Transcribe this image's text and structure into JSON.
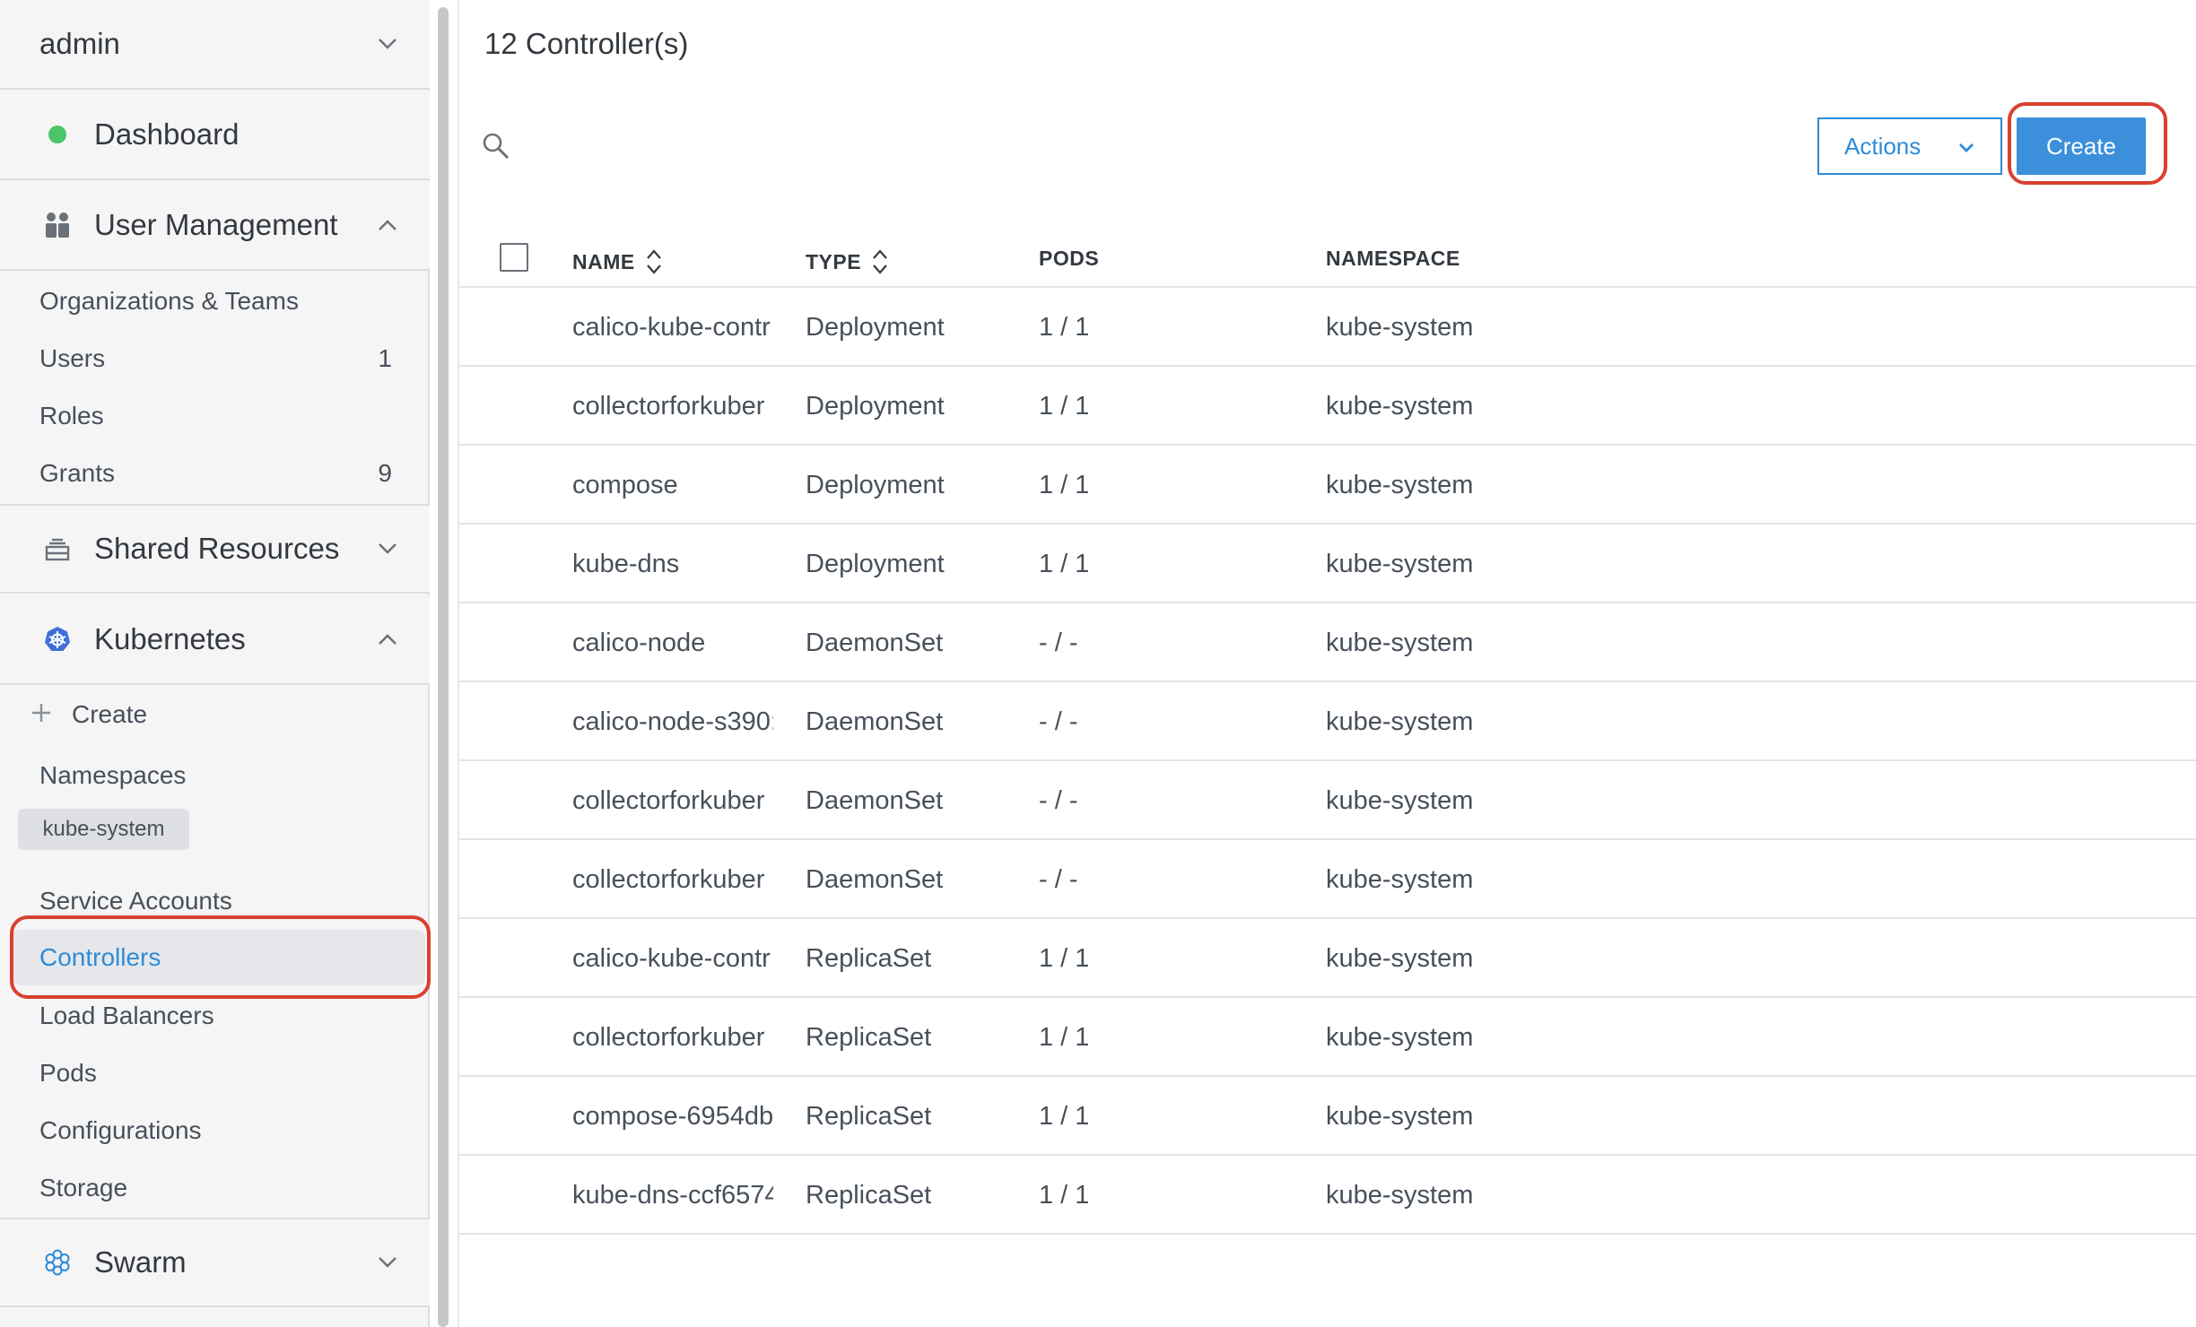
{
  "sidebar": {
    "user": "admin",
    "dashboard": "Dashboard",
    "user_management": "User Management",
    "um_items": [
      {
        "label": "Organizations & Teams",
        "count": ""
      },
      {
        "label": "Users",
        "count": "1"
      },
      {
        "label": "Roles",
        "count": ""
      },
      {
        "label": "Grants",
        "count": "9"
      }
    ],
    "shared_resources": "Shared Resources",
    "kubernetes": "Kubernetes",
    "k8s_create": "Create",
    "namespaces": "Namespaces",
    "namespace_chip": "kube-system",
    "k8s_items": [
      "Service Accounts",
      "Controllers",
      "Load Balancers",
      "Pods",
      "Configurations",
      "Storage"
    ],
    "swarm": "Swarm",
    "colors": {
      "dashboard_dot": "#4cc46a",
      "active_text": "#2d8bd8",
      "kubernetes_icon": "#3f6fd9",
      "swarm_icon": "#2d8bd8"
    }
  },
  "main": {
    "title": "12 Controller(s)",
    "actions_label": "Actions",
    "create_label": "Create",
    "icons": {
      "search": "search-icon",
      "sort": "sort-icon",
      "chevron": "chevron-down-icon"
    },
    "columns": {
      "name": "NAME",
      "type": "TYPE",
      "pods": "PODS",
      "namespace": "NAMESPACE"
    },
    "rows": [
      {
        "name": "calico-kube-contr",
        "type": "Deployment",
        "pods": "1 / 1",
        "namespace": "kube-system"
      },
      {
        "name": "collectorforkuber",
        "type": "Deployment",
        "pods": "1 / 1",
        "namespace": "kube-system"
      },
      {
        "name": "compose",
        "type": "Deployment",
        "pods": "1 / 1",
        "namespace": "kube-system"
      },
      {
        "name": "kube-dns",
        "type": "Deployment",
        "pods": "1 / 1",
        "namespace": "kube-system"
      },
      {
        "name": "calico-node",
        "type": "DaemonSet",
        "pods": "- / -",
        "namespace": "kube-system"
      },
      {
        "name": "calico-node-s390:",
        "type": "DaemonSet",
        "pods": "- / -",
        "namespace": "kube-system"
      },
      {
        "name": "collectorforkuber",
        "type": "DaemonSet",
        "pods": "- / -",
        "namespace": "kube-system"
      },
      {
        "name": "collectorforkuber",
        "type": "DaemonSet",
        "pods": "- / -",
        "namespace": "kube-system"
      },
      {
        "name": "calico-kube-contr",
        "type": "ReplicaSet",
        "pods": "1 / 1",
        "namespace": "kube-system"
      },
      {
        "name": "collectorforkuber",
        "type": "ReplicaSet",
        "pods": "1 / 1",
        "namespace": "kube-system"
      },
      {
        "name": "compose-6954db",
        "type": "ReplicaSet",
        "pods": "1 / 1",
        "namespace": "kube-system"
      },
      {
        "name": "kube-dns-ccf6574",
        "type": "ReplicaSet",
        "pods": "1 / 1",
        "namespace": "kube-system"
      }
    ]
  }
}
